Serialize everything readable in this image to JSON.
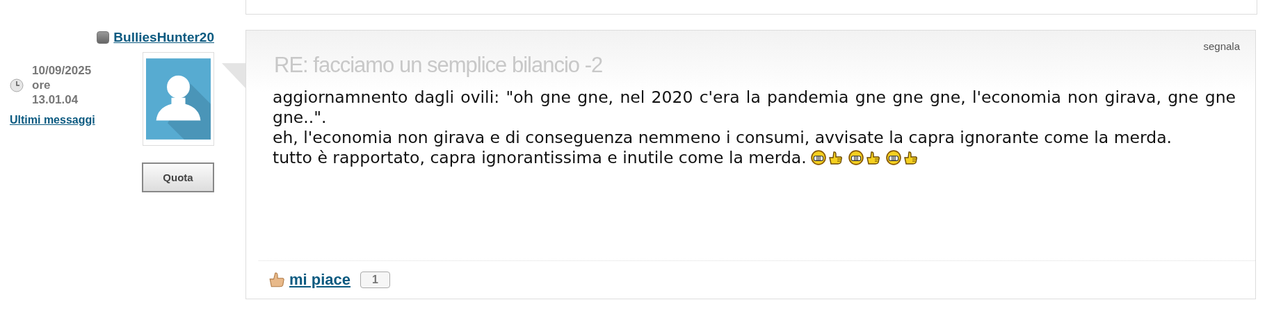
{
  "author": {
    "username": "BulliesHunter20",
    "online": false,
    "date": "10/09/2025",
    "time_prefix": "ore",
    "time": "13.01.04",
    "last_posts_link": "Ultimi messaggi",
    "quote_button": "Quota"
  },
  "post": {
    "title": "RE: facciamo un semplice bilancio -2",
    "report_link": "segnala",
    "paragraphs": [
      {
        "text": "aggiornamnento dagli ovili: \"oh gne gne, nel 2020 c'era la pandemia gne gne gne, l'economia non girava, gne gne gne..\"."
      },
      {
        "text": "eh, l'economia non girava e di conseguenza nemmeno i consumi, avvisate la capra ignorante come la merda."
      },
      {
        "text": "tutto è rapportato, capra ignorantissima e inutile come la merda.",
        "smileys": [
          {
            "kind": "grin"
          },
          {
            "kind": "thumbs-up"
          },
          {
            "kind": "grin"
          },
          {
            "kind": "thumbs-up"
          },
          {
            "kind": "grin"
          },
          {
            "kind": "thumbs-up"
          }
        ]
      }
    ],
    "like_link": "mi piace",
    "like_count": "1"
  }
}
